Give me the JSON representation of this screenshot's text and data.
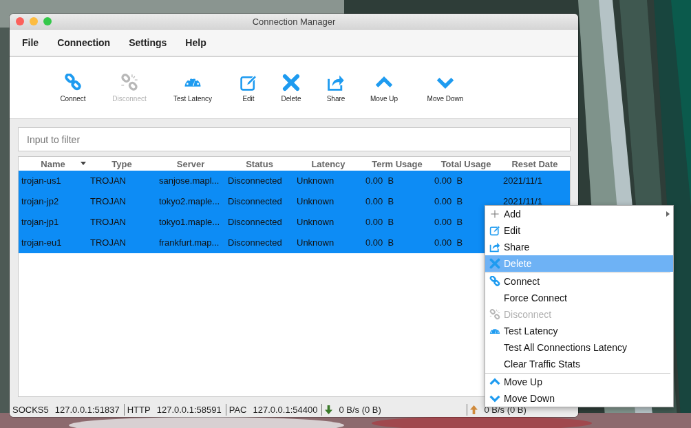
{
  "window": {
    "title": "Connection Manager"
  },
  "menu_bar": [
    "File",
    "Connection",
    "Settings",
    "Help"
  ],
  "toolbar": [
    {
      "kind": "connect",
      "label": "Connect",
      "disabled": false
    },
    {
      "kind": "disconnect",
      "label": "Disconnect",
      "disabled": true
    },
    {
      "kind": "latency",
      "label": "Test Latency",
      "disabled": false
    },
    {
      "kind": "edit",
      "label": "Edit",
      "disabled": false
    },
    {
      "kind": "delete",
      "label": "Delete",
      "disabled": false
    },
    {
      "kind": "share",
      "label": "Share",
      "disabled": false
    },
    {
      "kind": "moveup",
      "label": "Move Up",
      "disabled": false
    },
    {
      "kind": "movedown",
      "label": "Move Down",
      "disabled": false
    }
  ],
  "filter": {
    "placeholder": "Input to filter"
  },
  "table": {
    "columns": [
      {
        "label": "Name",
        "sorted": true
      },
      {
        "label": "Type",
        "sorted": false
      },
      {
        "label": "Server",
        "sorted": false
      },
      {
        "label": "Status",
        "sorted": false
      },
      {
        "label": "Latency",
        "sorted": false
      },
      {
        "label": "Term Usage",
        "sorted": false
      },
      {
        "label": "Total Usage",
        "sorted": false
      },
      {
        "label": "Reset Date",
        "sorted": false
      }
    ],
    "rows": [
      {
        "selected": true,
        "cells": [
          "trojan-us1",
          "TROJAN",
          "sanjose.mapl...",
          "Disconnected",
          "Unknown",
          "0.00  B",
          "0.00  B",
          "2021/11/1"
        ]
      },
      {
        "selected": true,
        "cells": [
          "trojan-jp2",
          "TROJAN",
          "tokyo2.maple...",
          "Disconnected",
          "Unknown",
          "0.00  B",
          "0.00  B",
          "2021/11/1"
        ]
      },
      {
        "selected": true,
        "cells": [
          "trojan-jp1",
          "TROJAN",
          "tokyo1.maple...",
          "Disconnected",
          "Unknown",
          "0.00  B",
          "0.00  B"
        ]
      },
      {
        "selected": true,
        "cells": [
          "trojan-eu1",
          "TROJAN",
          "frankfurt.map...",
          "Disconnected",
          "Unknown",
          "0.00  B",
          "0.00  B"
        ]
      }
    ]
  },
  "status_bar": [
    {
      "kind": "text",
      "label": "SOCKS5",
      "value": "127.0.0.1:51837"
    },
    {
      "kind": "text",
      "label": "HTTP",
      "value": "127.0.0.1:58591"
    },
    {
      "kind": "text",
      "label": "PAC",
      "value": "127.0.0.1:54400"
    },
    {
      "kind": "download",
      "value": "0 B/s (0 B)"
    },
    {
      "kind": "upload",
      "value": "0 B/s (0 B)"
    }
  ],
  "context_menu": [
    {
      "kind": "add",
      "label": "Add",
      "selected": false,
      "disabled": false,
      "submenu": true
    },
    {
      "kind": "edit",
      "label": "Edit",
      "selected": false,
      "disabled": false,
      "submenu": false
    },
    {
      "kind": "share",
      "label": "Share",
      "selected": false,
      "disabled": false,
      "submenu": false
    },
    {
      "kind": "delete",
      "label": "Delete",
      "selected": true,
      "disabled": false,
      "submenu": false
    },
    {
      "kind": "separator"
    },
    {
      "kind": "connect",
      "label": "Connect",
      "selected": false,
      "disabled": false,
      "submenu": false
    },
    {
      "kind": "plain",
      "label": "Force Connect",
      "selected": false,
      "disabled": false,
      "submenu": false
    },
    {
      "kind": "disconnect",
      "label": "Disconnect",
      "selected": false,
      "disabled": true,
      "submenu": false
    },
    {
      "kind": "latency",
      "label": "Test Latency",
      "selected": false,
      "disabled": false,
      "submenu": false
    },
    {
      "kind": "plain",
      "label": "Test All Connections Latency",
      "selected": false,
      "disabled": false,
      "submenu": false
    },
    {
      "kind": "plain",
      "label": "Clear Traffic Stats",
      "selected": false,
      "disabled": false,
      "submenu": false
    },
    {
      "kind": "separator"
    },
    {
      "kind": "moveup",
      "label": "Move Up",
      "selected": false,
      "disabled": false,
      "submenu": false
    },
    {
      "kind": "movedown",
      "label": "Move Down",
      "selected": false,
      "disabled": false,
      "submenu": false
    }
  ]
}
